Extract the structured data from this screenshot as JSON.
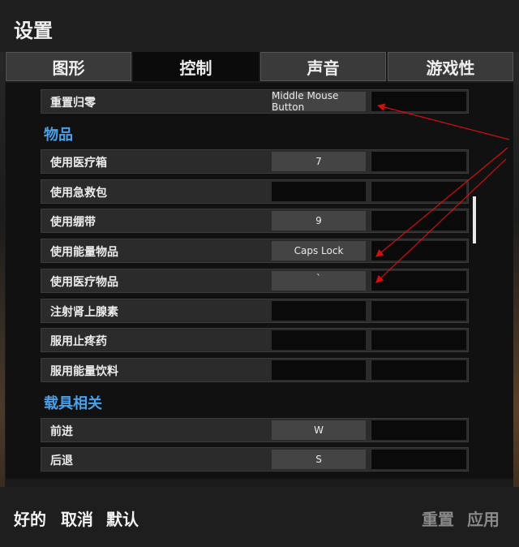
{
  "window": {
    "title": "设置"
  },
  "tabs": [
    {
      "label": "图形",
      "active": false
    },
    {
      "label": "控制",
      "active": true
    },
    {
      "label": "声音",
      "active": false
    },
    {
      "label": "游戏性",
      "active": false
    }
  ],
  "content": {
    "top_row": {
      "label": "重置归零",
      "key1": "Middle Mouse Button",
      "key2": ""
    },
    "sections": [
      {
        "title": "物品",
        "rows": [
          {
            "label": "使用医疗箱",
            "key1": "7",
            "key2": ""
          },
          {
            "label": "使用急救包",
            "key1": "",
            "key2": ""
          },
          {
            "label": "使用绷带",
            "key1": "9",
            "key2": ""
          },
          {
            "label": "使用能量物品",
            "key1": "Caps Lock",
            "key2": ""
          },
          {
            "label": "使用医疗物品",
            "key1": "`",
            "key2": ""
          },
          {
            "label": "注射肾上腺素",
            "key1": "",
            "key2": ""
          },
          {
            "label": "服用止疼药",
            "key1": "",
            "key2": ""
          },
          {
            "label": "服用能量饮料",
            "key1": "",
            "key2": ""
          }
        ]
      },
      {
        "title": "载具相关",
        "rows": [
          {
            "label": "前进",
            "key1": "W",
            "key2": ""
          },
          {
            "label": "后退",
            "key1": "S",
            "key2": ""
          }
        ]
      }
    ]
  },
  "footer": {
    "ok_label": "好的",
    "cancel_label": "取消",
    "default_label": "默认",
    "reset_label": "重置",
    "apply_label": "应用"
  },
  "colors": {
    "section_title": "#4aa0e8",
    "annotation_arrow": "#d01010"
  }
}
